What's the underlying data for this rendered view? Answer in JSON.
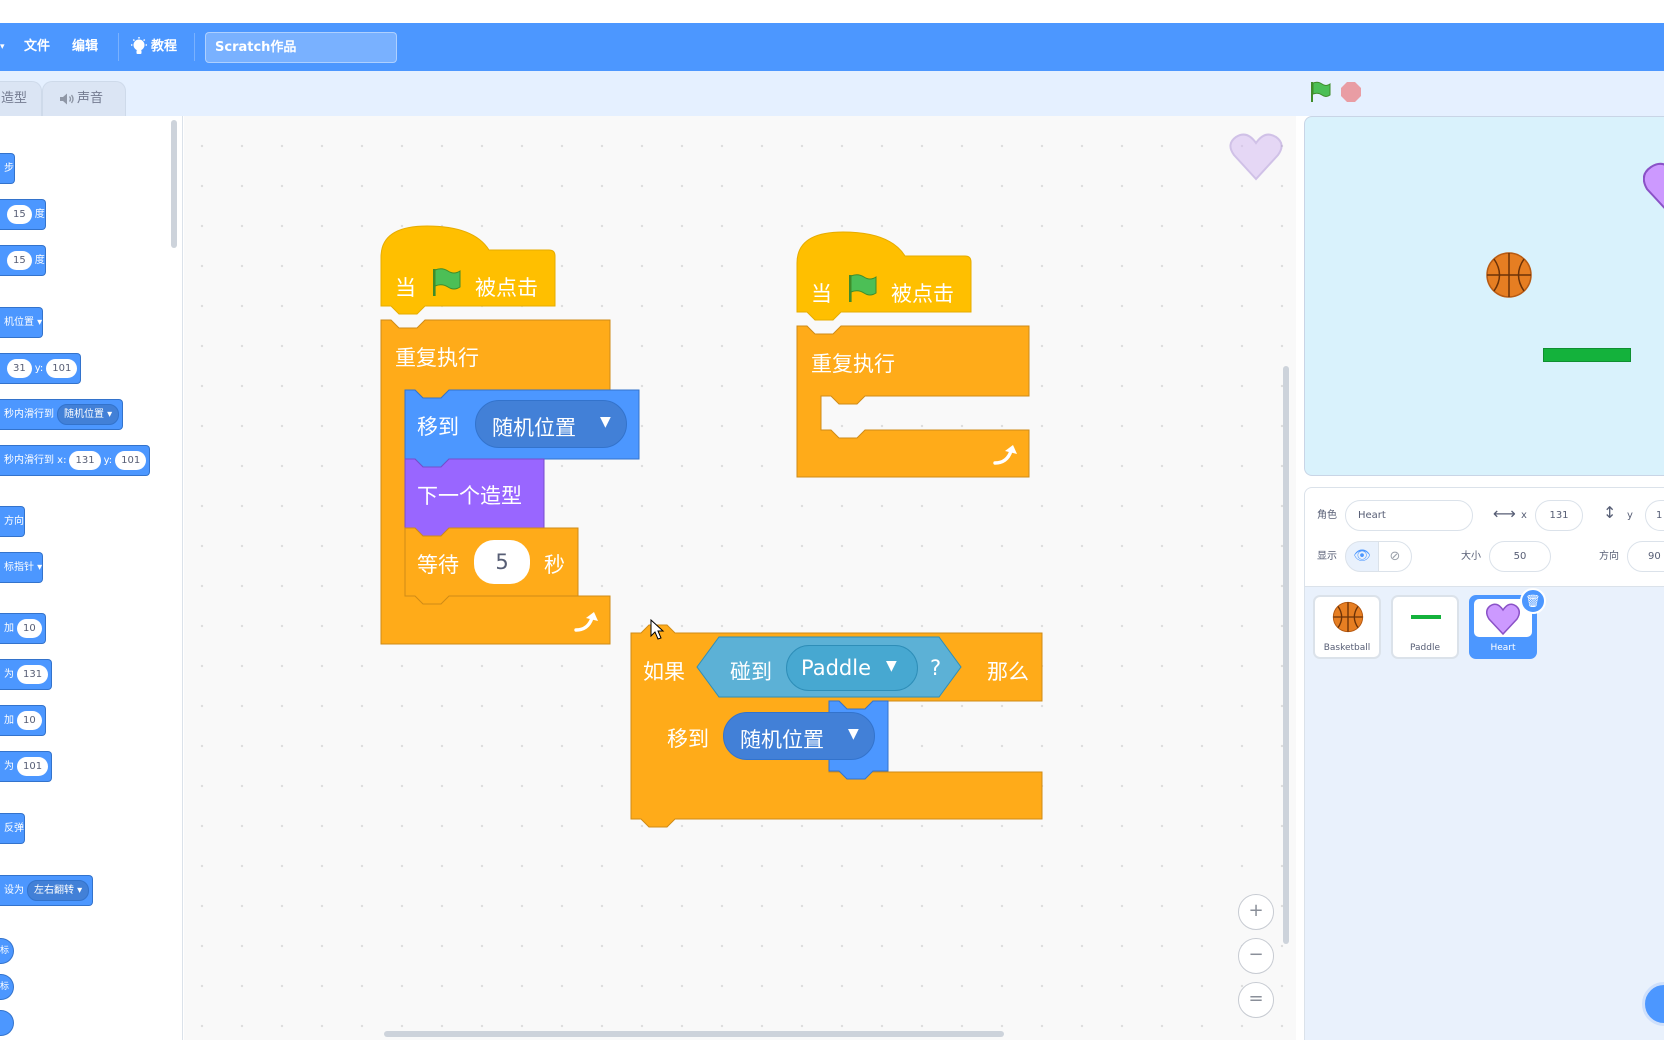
{
  "menu": {
    "file_label": "文件",
    "edit_label": "编辑",
    "tutorial_label": "教程",
    "project_title": "Scratch作品"
  },
  "tabs": {
    "costumes_label": "造型",
    "sounds_label": "声音"
  },
  "palette": {
    "items": [
      {
        "text_a": "步"
      },
      {
        "in1": "15",
        "text_a": "度"
      },
      {
        "in1": "15",
        "text_a": "度"
      },
      {
        "dd1": "机位置"
      },
      {
        "in1": "31",
        "text_a": "y:",
        "in2": "101"
      },
      {
        "text_a": "秒内滑行到",
        "dd1": "随机位置"
      },
      {
        "text_a": "秒内滑行到 x:",
        "in1": "131",
        "text_b": "y:",
        "in2": "101"
      },
      {
        "text_a": "方向"
      },
      {
        "dd1": "标指针"
      },
      {
        "text_a": "加",
        "in1": "10"
      },
      {
        "text_a": "为",
        "in1": "131"
      },
      {
        "text_a": "加",
        "in1": "10"
      },
      {
        "text_a": "为",
        "in1": "101"
      },
      {
        "text_a": "反弹"
      },
      {
        "text_a": "设为",
        "dd1": "左右翻转"
      },
      {
        "text_a": "标"
      },
      {
        "text_a": "标"
      }
    ]
  },
  "scripts": {
    "hat_when": "当",
    "hat_clicked": "被点击",
    "forever": "重复执行",
    "goto": "移到",
    "goto_target": "随机位置",
    "next_costume": "下一个造型",
    "wait": "等待",
    "wait_value": "5",
    "wait_unit": "秒",
    "if": "如果",
    "touching": "碰到",
    "touching_target": "Paddle",
    "question_mark": "?",
    "then": "那么"
  },
  "zoom": {
    "in": "+",
    "out": "−",
    "reset": "="
  },
  "sprite_info": {
    "sprite_label": "角色",
    "sprite_name": "Heart",
    "x_label": "x",
    "x_value": "131",
    "y_label": "y",
    "y_value": "1",
    "show_label": "显示",
    "size_label": "大小",
    "size_value": "50",
    "direction_label": "方向",
    "direction_value": "90"
  },
  "sprites": [
    {
      "name": "Basketball"
    },
    {
      "name": "Paddle"
    },
    {
      "name": "Heart",
      "selected": true
    }
  ],
  "colors": {
    "menu_bar": "#4c97ff",
    "motion": "#4c97ff",
    "control": "#ffab19",
    "events": "#ffbf00",
    "looks": "#9966ff",
    "sensing": "#5cb1d6",
    "stage_bg": "#d9f2fc"
  }
}
